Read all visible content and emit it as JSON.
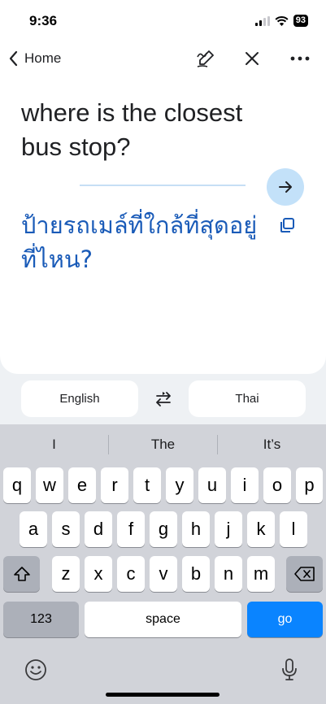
{
  "status_bar": {
    "time": "9:36",
    "battery": "93"
  },
  "nav": {
    "back_label": "Home"
  },
  "translation": {
    "source_text": "where is the closest bus stop?",
    "translated_text": "ป้ายรถเมล์ที่ใกล้ที่สุดอยู่ที่ไหน?"
  },
  "languages": {
    "source": "English",
    "target": "Thai"
  },
  "keyboard": {
    "suggestions": [
      "I",
      "The",
      "It’s"
    ],
    "row1": [
      "q",
      "w",
      "e",
      "r",
      "t",
      "y",
      "u",
      "i",
      "o",
      "p"
    ],
    "row2": [
      "a",
      "s",
      "d",
      "f",
      "g",
      "h",
      "j",
      "k",
      "l"
    ],
    "row3": [
      "z",
      "x",
      "c",
      "v",
      "b",
      "n",
      "m"
    ],
    "numbers_label": "123",
    "space_label": "space",
    "go_label": "go"
  },
  "colors": {
    "accent": "#1a5bb8",
    "arrow_button": "#c3e1f9",
    "go_key": "#0a84ff"
  },
  "icons": [
    "chevron-left-icon",
    "handwriting-icon",
    "close-icon",
    "more-icon",
    "arrow-right-icon",
    "copy-icon",
    "swap-icon",
    "shift-icon",
    "backspace-icon",
    "emoji-icon",
    "microphone-icon"
  ]
}
